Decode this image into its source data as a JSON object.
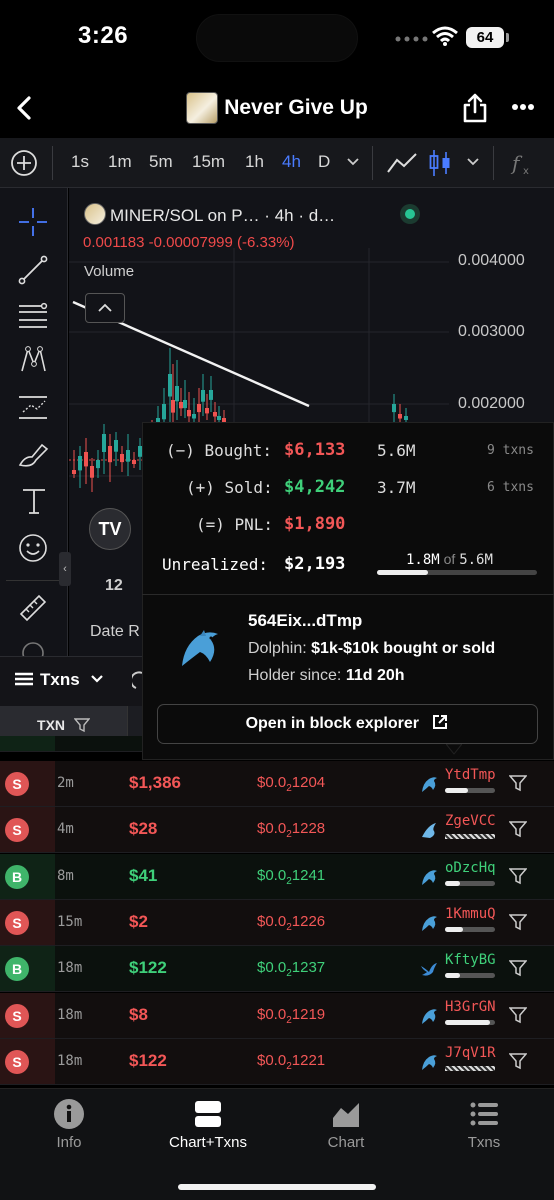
{
  "status": {
    "time": "3:26",
    "battery": "64"
  },
  "header": {
    "title": "Never Give Up"
  },
  "toolbar": {
    "timeframes": [
      "1s",
      "1m",
      "5m",
      "15m",
      "1h",
      "4h",
      "D"
    ],
    "active": "4h"
  },
  "chart": {
    "pair": "MINER/SOL on P… · 4h · d…",
    "price_line": "0.001183  -0.00007999 (-6.33%)",
    "volume_label": "Volume",
    "y_ticks": [
      "0.004000",
      "0.003000",
      "0.002000"
    ],
    "x_tick": "12",
    "date_range": "Date R",
    "tv_logo": "TV"
  },
  "popup": {
    "bought_label": "(−) Bought:",
    "bought_usd": "$6,133",
    "bought_tokens": "5.6M",
    "bought_txns": "9 txns",
    "sold_label": "(+) Sold:",
    "sold_usd": "$4,242",
    "sold_tokens": "3.7M",
    "sold_txns": "6 txns",
    "pnl_label": "(=) PNL:",
    "pnl_usd": "$1,890",
    "unrealized_label": "Unrealized:",
    "unrealized_usd": "$2,193",
    "unrealized_held": "1.8M",
    "unrealized_of": "of",
    "unrealized_total": "5.6M",
    "unrealized_fraction": 0.32,
    "wallet": "564Eix...dTmp",
    "dolphin_label": "Dolphin:",
    "dolphin_desc": "$1k-$10k bought or sold",
    "holder_label": "Holder since:",
    "holder_value": "11d 20h",
    "explorer_button": "Open in block explorer"
  },
  "txns": {
    "tab_label": "Txns",
    "col_txn": "TXN",
    "rows": [
      {
        "type": "S",
        "age": "2m",
        "usd": "$1,386",
        "price_prefix": "$0.0",
        "price_sub": "2",
        "price_rest": "1204",
        "maker": "YtdTmp",
        "fill": 0.45,
        "icon": "dolphin-icon"
      },
      {
        "type": "S",
        "age": "4m",
        "usd": "$28",
        "price_prefix": "$0.0",
        "price_sub": "2",
        "price_rest": "1228",
        "maker": "ZgeVCC",
        "fill": 1,
        "icon": "shark-icon"
      },
      {
        "type": "B",
        "age": "8m",
        "usd": "$41",
        "price_prefix": "$0.0",
        "price_sub": "2",
        "price_rest": "1241",
        "maker": "oDzcHq",
        "fill": 0.3,
        "icon": "dolphin-icon"
      },
      {
        "type": "S",
        "age": "15m",
        "usd": "$2",
        "price_prefix": "$0.0",
        "price_sub": "2",
        "price_rest": "1226",
        "maker": "1KmmuQ",
        "fill": 0.35,
        "icon": "dolphin-icon"
      },
      {
        "type": "B",
        "age": "18m",
        "usd": "$122",
        "price_prefix": "$0.0",
        "price_sub": "2",
        "price_rest": "1237",
        "maker": "KftyBG",
        "fill": 0.3,
        "icon": "bird-icon"
      },
      {
        "type": "S",
        "age": "18m",
        "usd": "$8",
        "price_prefix": "$0.0",
        "price_sub": "2",
        "price_rest": "1219",
        "maker": "H3GrGN",
        "fill": 0.9,
        "icon": "dolphin-icon"
      },
      {
        "type": "S",
        "age": "18m",
        "usd": "$122",
        "price_prefix": "$0.0",
        "price_sub": "2",
        "price_rest": "1221",
        "maker": "J7qV1R",
        "fill": 1,
        "icon": "dolphin-icon"
      }
    ]
  },
  "tabs": [
    {
      "label": "Info",
      "icon": "info-icon"
    },
    {
      "label": "Chart+Txns",
      "icon": "split-icon"
    },
    {
      "label": "Chart",
      "icon": "chart-icon"
    },
    {
      "label": "Txns",
      "icon": "list-icon"
    }
  ],
  "colors": {
    "red": "#f35757",
    "green": "#3fd07a",
    "accent": "#4a7cff"
  }
}
